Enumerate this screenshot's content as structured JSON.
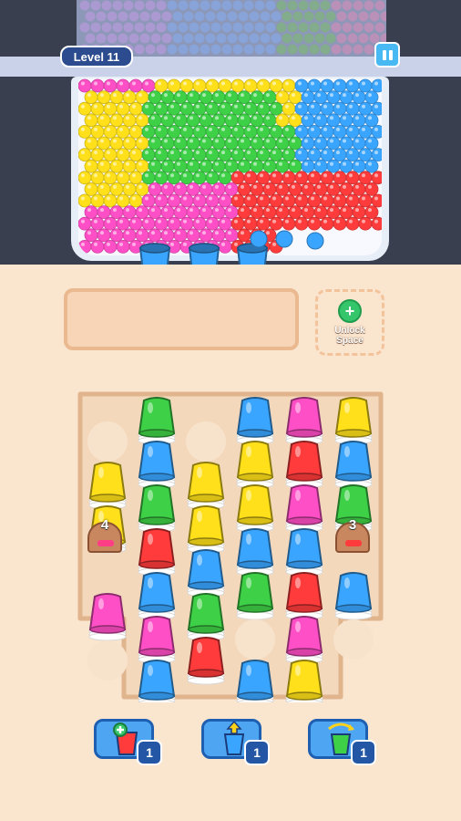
{
  "hud": {
    "level_label": "Level 11",
    "pause_icon": "pause-icon"
  },
  "colors": {
    "yellow": "#ffe01a",
    "blue": "#3aa5ff",
    "green": "#3ed046",
    "red": "#ff3b3b",
    "pink": "#ff4fc6",
    "background": "#fae5cf",
    "tank_frame": "#3a3f4f"
  },
  "tank": {
    "regions": [
      "pink",
      "yellow",
      "green",
      "blue",
      "red"
    ]
  },
  "launch_cups": [
    "blue",
    "blue",
    "blue"
  ],
  "queue_slot": {
    "unlock_label": "Unlock\nSpace",
    "unlock_icon": "plus-icon"
  },
  "board": {
    "columns": [
      [
        "empty",
        "yellow",
        "yellow",
        "pink_pile:4",
        "pink",
        "empty"
      ],
      [
        "green",
        "blue",
        "green",
        "red",
        "blue",
        "pink",
        "blue"
      ],
      [
        "empty",
        "yellow",
        "yellow",
        "blue",
        "green",
        "red",
        "pink"
      ],
      [
        "blue",
        "yellow",
        "yellow",
        "blue",
        "green",
        "empty",
        "blue"
      ],
      [
        "pink",
        "red",
        "pink",
        "blue",
        "red",
        "pink",
        "yellow"
      ],
      [
        "yellow",
        "blue",
        "green",
        "red_pile:3",
        "blue",
        "empty"
      ]
    ],
    "piles": [
      {
        "count": "4",
        "color": "pink"
      },
      {
        "count": "3",
        "color": "red"
      }
    ]
  },
  "boosters": [
    {
      "icon": "add-cup-icon",
      "count": "1"
    },
    {
      "icon": "lift-cup-icon",
      "count": "1"
    },
    {
      "icon": "shuffle-cup-icon",
      "count": "1"
    }
  ]
}
